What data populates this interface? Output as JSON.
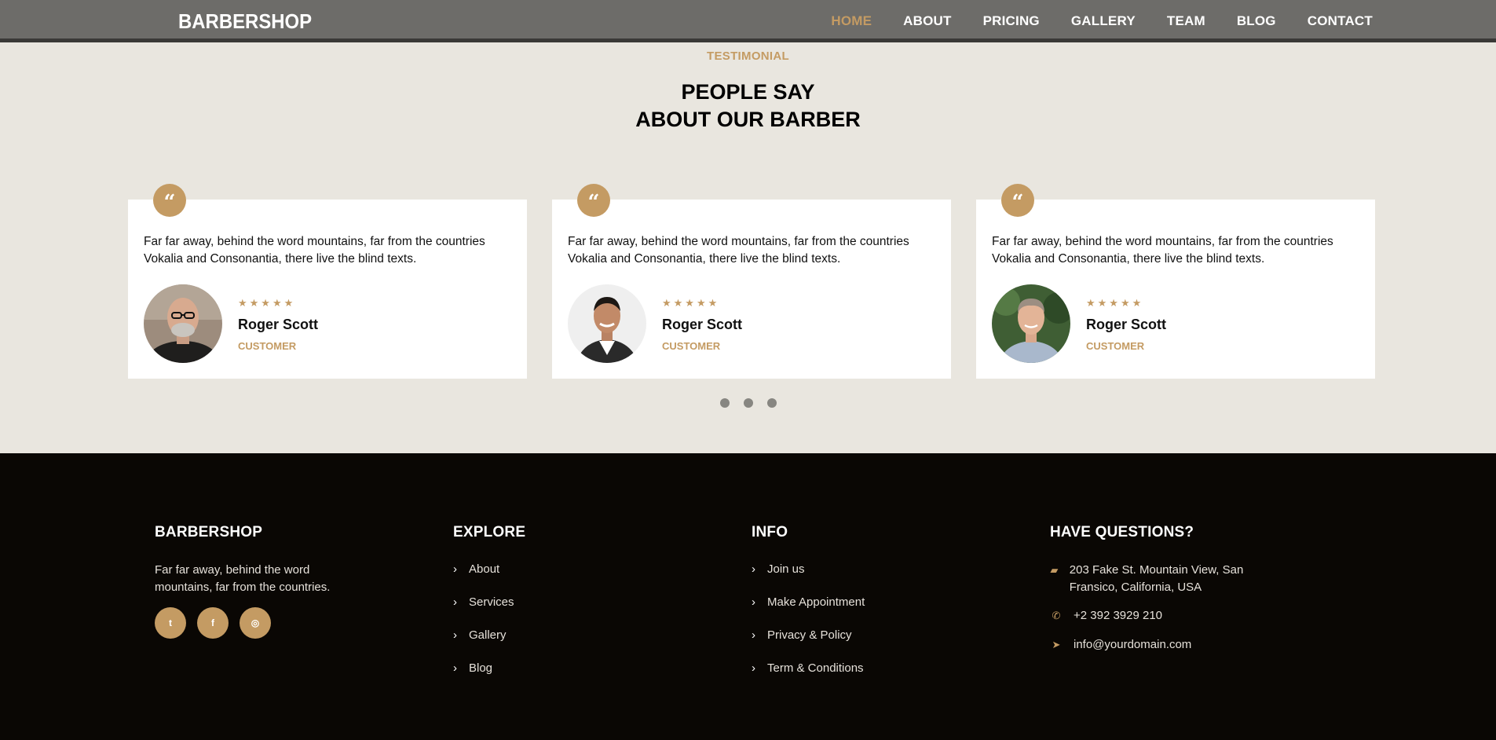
{
  "nav": {
    "brand": "BARBERSHOP",
    "links": [
      {
        "label": "HOME"
      },
      {
        "label": "ABOUT"
      },
      {
        "label": "PRICING"
      },
      {
        "label": "GALLERY"
      },
      {
        "label": "TEAM"
      },
      {
        "label": "BLOG"
      },
      {
        "label": "CONTACT"
      }
    ],
    "active_link": "HOME"
  },
  "testimonial": {
    "subheading": "TESTIMONIAL",
    "heading_line1": "PEOPLE SAY",
    "heading_line2": "ABOUT OUR BARBER",
    "cards": [
      {
        "quote_icon": "quote-icon",
        "text": "Far far away, behind the word mountains, far from the countries Vokalia and Consonantia, there live the blind texts.",
        "rating": 5,
        "stars": "★★★★★",
        "name": "Roger Scott",
        "role": "CUSTOMER"
      },
      {
        "quote_icon": "quote-icon",
        "text": "Far far away, behind the word mountains, far from the countries Vokalia and Consonantia, there live the blind texts.",
        "rating": 5,
        "stars": "★★★★★",
        "name": "Roger Scott",
        "role": "CUSTOMER"
      },
      {
        "quote_icon": "quote-icon",
        "text": "Far far away, behind the word mountains, far from the countries Vokalia and Consonantia, there live the blind texts.",
        "rating": 5,
        "stars": "★★★★★",
        "name": "Roger Scott",
        "role": "CUSTOMER"
      }
    ],
    "dots_count": 3
  },
  "footer": {
    "about": {
      "title": "BARBERSHOP",
      "text": "Far far away, behind the word mountains, far from the countries.",
      "socials": [
        {
          "icon": "twitter-icon",
          "glyph": "t"
        },
        {
          "icon": "facebook-icon",
          "glyph": "f"
        },
        {
          "icon": "instagram-icon",
          "glyph": "◎"
        }
      ]
    },
    "explore": {
      "title": "EXPLORE",
      "items": [
        "About",
        "Services",
        "Gallery",
        "Blog"
      ]
    },
    "info": {
      "title": "INFO",
      "items": [
        "Join us",
        "Make Appointment",
        "Privacy & Policy",
        "Term & Conditions"
      ]
    },
    "questions": {
      "title": "HAVE QUESTIONS?",
      "address": "203 Fake St. Mountain View, San Fransico, California, USA",
      "phone": "+2 392 3929 210",
      "email": "info@yourdomain.com"
    }
  },
  "colors": {
    "accent": "#c49b63",
    "nav_bg": "#6d6c69",
    "section_bg": "#e9e6df",
    "footer_bg": "#0a0704"
  }
}
